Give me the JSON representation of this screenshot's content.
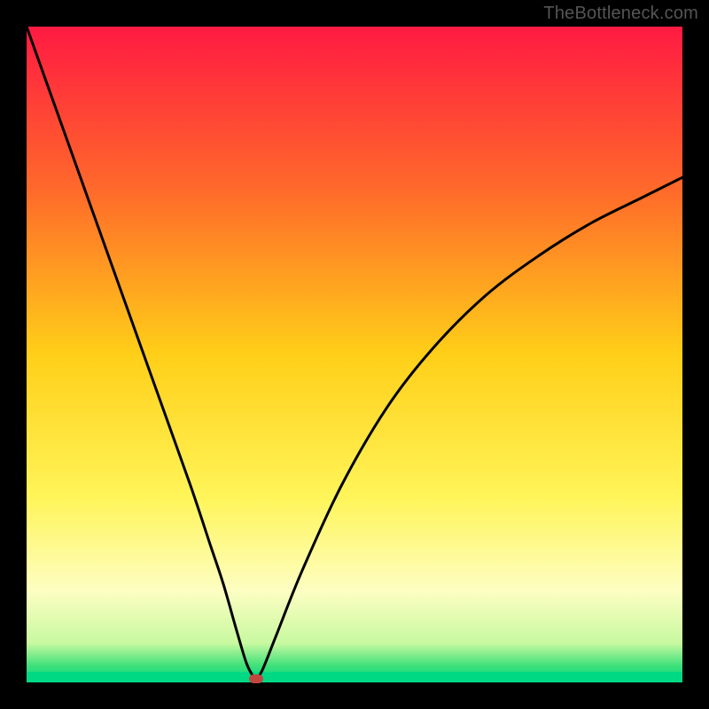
{
  "watermark": "TheBottleneck.com",
  "chart_data": {
    "type": "line",
    "title": "",
    "xlabel": "",
    "ylabel": "",
    "xlim": [
      0,
      100
    ],
    "ylim": [
      0,
      100
    ],
    "grid": false,
    "legend": false,
    "gradient_stops": [
      {
        "offset": 0.0,
        "color": "#ff1a42"
      },
      {
        "offset": 0.25,
        "color": "#ff6a2a"
      },
      {
        "offset": 0.5,
        "color": "#ffcf18"
      },
      {
        "offset": 0.72,
        "color": "#fff55a"
      },
      {
        "offset": 0.86,
        "color": "#fdfec2"
      },
      {
        "offset": 0.94,
        "color": "#c8f9a0"
      },
      {
        "offset": 0.975,
        "color": "#3de07a"
      },
      {
        "offset": 1.0,
        "color": "#00d984"
      }
    ],
    "series": [
      {
        "name": "bottleneck-curve",
        "color": "#000000",
        "x": [
          0,
          5,
          10,
          15,
          20,
          25,
          28,
          30,
          32,
          33.5,
          34.5,
          35,
          36,
          38,
          42,
          48,
          55,
          62,
          70,
          78,
          86,
          94,
          100
        ],
        "y": [
          100,
          86,
          72,
          58,
          44,
          30,
          21,
          15,
          8,
          3,
          1,
          0.5,
          2,
          7,
          17,
          30,
          42,
          51,
          59,
          65,
          70,
          74,
          77
        ]
      }
    ],
    "marker": {
      "name": "optimal-point",
      "x": 35,
      "y": 0.5,
      "color": "#c0473f"
    },
    "bottom_band_color": "#00d984"
  }
}
